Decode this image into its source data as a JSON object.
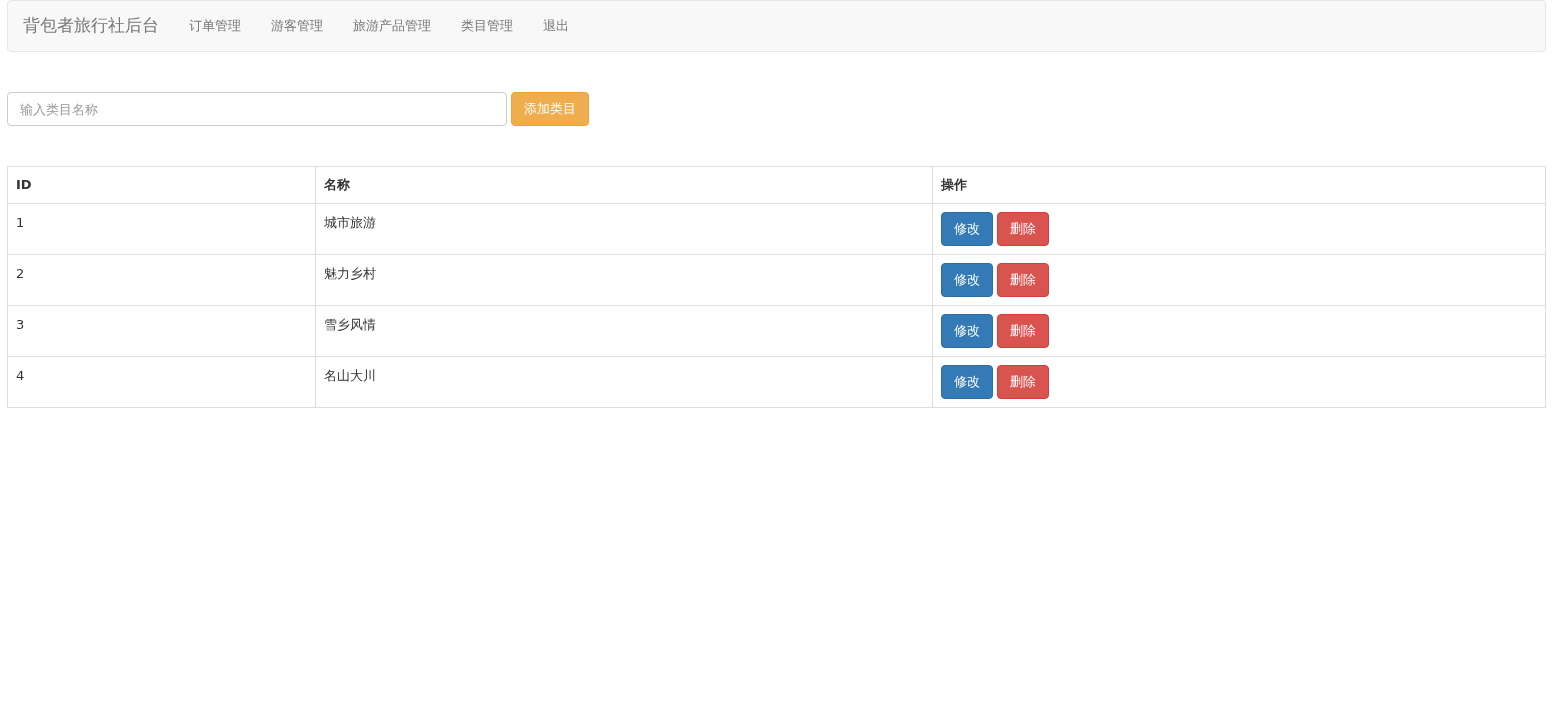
{
  "navbar": {
    "brand": "背包者旅行社后台",
    "items": [
      "订单管理",
      "游客管理",
      "旅游产品管理",
      "类目管理",
      "退出"
    ]
  },
  "add_form": {
    "placeholder": "输入类目名称",
    "button": "添加类目"
  },
  "table": {
    "columns": [
      "ID",
      "名称",
      "操作"
    ],
    "rows": [
      {
        "id": "1",
        "name": "城市旅游",
        "actions": [
          {
            "kind": "edit",
            "label": "修改"
          },
          {
            "kind": "delete",
            "label": "删除"
          }
        ]
      },
      {
        "id": "2",
        "name": "魅力乡村",
        "actions": [
          {
            "kind": "edit",
            "label": "修改"
          },
          {
            "kind": "delete",
            "label": "删除"
          }
        ]
      },
      {
        "id": "3",
        "name": "雪乡风情",
        "actions": [
          {
            "kind": "edit",
            "label": "修改"
          },
          {
            "kind": "delete",
            "label": "删除"
          }
        ]
      },
      {
        "id": "4",
        "name": "名山大川",
        "actions": [
          {
            "kind": "edit",
            "label": "修改"
          },
          {
            "kind": "delete",
            "label": "删除"
          }
        ]
      }
    ]
  }
}
